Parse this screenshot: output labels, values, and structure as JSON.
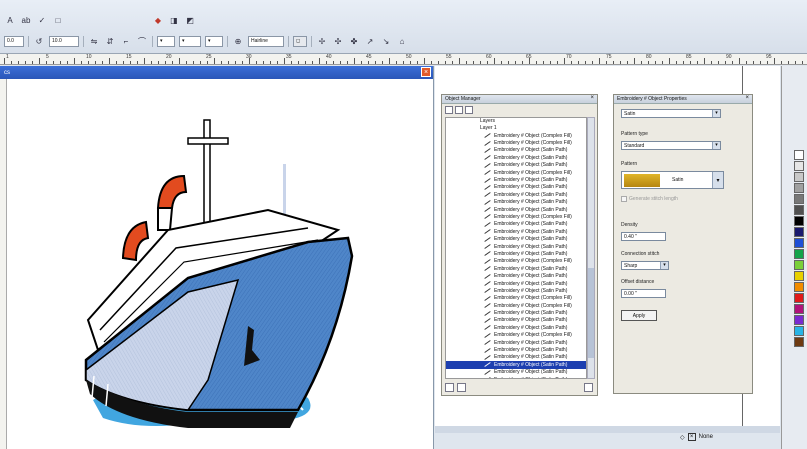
{
  "toolbar": {
    "row1": [
      "A",
      "ab",
      "✓",
      "□"
    ],
    "row1b": [
      "◆",
      "◨",
      "◩"
    ],
    "row2_fields": [
      "10.0",
      "▾",
      "▾",
      "▾"
    ],
    "zoom": "Hairline"
  },
  "ruler_labels": [
    "1",
    "5",
    "10",
    "15",
    "20",
    "25",
    "30",
    "35",
    "40",
    "45",
    "50",
    "55",
    "60",
    "65",
    "70",
    "75",
    "80",
    "85",
    "90",
    "95"
  ],
  "drawing_window": {
    "title": "cs",
    "close_glyph": "×"
  },
  "object_manager": {
    "title": "Object Manager",
    "close_glyph": "×",
    "layers": [
      "Layers",
      "Layer 1"
    ],
    "items": [
      "Embroidery # Object (Complex Fill)",
      "Embroidery # Object (Complex Fill)",
      "Embroidery # Object (Satin Path)",
      "Embroidery # Object (Satin Path)",
      "Embroidery # Object (Satin Path)",
      "Embroidery # Object (Complex Fill)",
      "Embroidery # Object (Satin Path)",
      "Embroidery # Object (Satin Path)",
      "Embroidery # Object (Satin Path)",
      "Embroidery # Object (Satin Path)",
      "Embroidery # Object (Satin Path)",
      "Embroidery # Object (Complex Fill)",
      "Embroidery # Object (Satin Path)",
      "Embroidery # Object (Satin Path)",
      "Embroidery # Object (Satin Path)",
      "Embroidery # Object (Satin Path)",
      "Embroidery # Object (Satin Path)",
      "Embroidery # Object (Complex Fill)",
      "Embroidery # Object (Satin Path)",
      "Embroidery # Object (Satin Path)",
      "Embroidery # Object (Satin Path)",
      "Embroidery # Object (Satin Path)",
      "Embroidery # Object (Complex Fill)",
      "Embroidery # Object (Complex Fill)",
      "Embroidery # Object (Satin Path)",
      "Embroidery # Object (Satin Path)",
      "Embroidery # Object (Satin Path)",
      "Embroidery # Object (Complex Fill)",
      "Embroidery # Object (Satin Path)",
      "Embroidery # Object (Satin Path)",
      "Embroidery # Object (Satin Path)",
      "Embroidery # Object (Satin Path)",
      "Embroidery # Object (Satin Path)",
      "Embroidery # Object (Satin Path)"
    ],
    "selected_index": 31
  },
  "properties": {
    "title": "Embroidery # Object Properties",
    "close_glyph": "×",
    "type_value": "Satin",
    "pattern_type_label": "Pattern type",
    "pattern_type_value": "Standard",
    "pattern_label": "Pattern",
    "pattern_value": "Satin",
    "checkbox_label": "Generate stitch length",
    "density_label": "Density",
    "density_value": "0.40 \"",
    "connection_label": "Connection stitch",
    "connection_value": "Sharp",
    "offset_label": "Offset distance",
    "offset_value": "0.00 \"",
    "apply_label": "Apply"
  },
  "palette_colors": [
    "#ffffff",
    "#e6e6e6",
    "#c8c8c8",
    "#a0a0a0",
    "#787878",
    "#505050",
    "#000000",
    "#1a1a6e",
    "#1f4fd6",
    "#15a34a",
    "#7ad03a",
    "#e8d000",
    "#f28c00",
    "#e01a1a",
    "#b0127a",
    "#7a2ad0",
    "#28b4e6",
    "#6e3a12"
  ],
  "status": {
    "none_label": "None",
    "x_glyph": "×"
  },
  "colors": {
    "hull": "#4f86c9",
    "hull_light": "#c9d4ea",
    "water": "#41a6e0",
    "funnel": "#e24b1f",
    "title_blue": "#2a56b8",
    "selection": "#1d3fb0"
  }
}
